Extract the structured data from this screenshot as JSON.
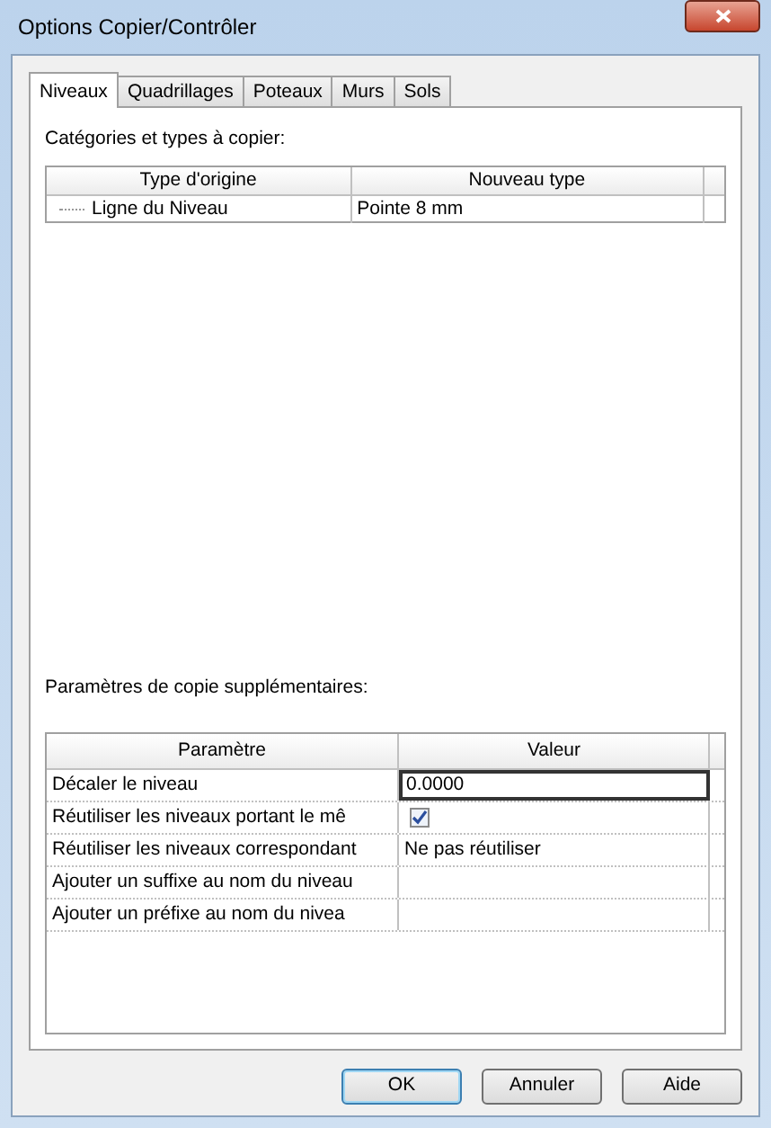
{
  "window": {
    "title": "Options Copier/Contrôler"
  },
  "tabs": [
    {
      "label": "Niveaux",
      "selected": true
    },
    {
      "label": "Quadrillages",
      "selected": false
    },
    {
      "label": "Poteaux",
      "selected": false
    },
    {
      "label": "Murs",
      "selected": false
    },
    {
      "label": "Sols",
      "selected": false
    }
  ],
  "categories": {
    "label": "Catégories et types à copier:",
    "columns": [
      "Type d'origine",
      "Nouveau type"
    ],
    "rows": [
      {
        "original": "Ligne du Niveau",
        "new_type": "Pointe 8 mm"
      }
    ]
  },
  "parameters": {
    "label": "Paramètres de copie supplémentaires:",
    "columns": [
      "Paramètre",
      "Valeur"
    ],
    "rows": [
      {
        "name": "Décaler le niveau",
        "kind": "field",
        "value": "0.0000"
      },
      {
        "name": "Réutiliser les niveaux portant le mê",
        "kind": "checkbox",
        "checked": true
      },
      {
        "name": "Réutiliser les niveaux correspondant",
        "kind": "text",
        "value": "Ne pas réutiliser"
      },
      {
        "name": "Ajouter un suffixe au nom du niveau",
        "kind": "text"
      },
      {
        "name": "Ajouter un préfixe au nom du nivea",
        "kind": "text"
      }
    ]
  },
  "buttons": [
    {
      "label": "OK",
      "default": true
    },
    {
      "label": "Annuler",
      "default": false
    },
    {
      "label": "Aide",
      "default": false
    }
  ]
}
